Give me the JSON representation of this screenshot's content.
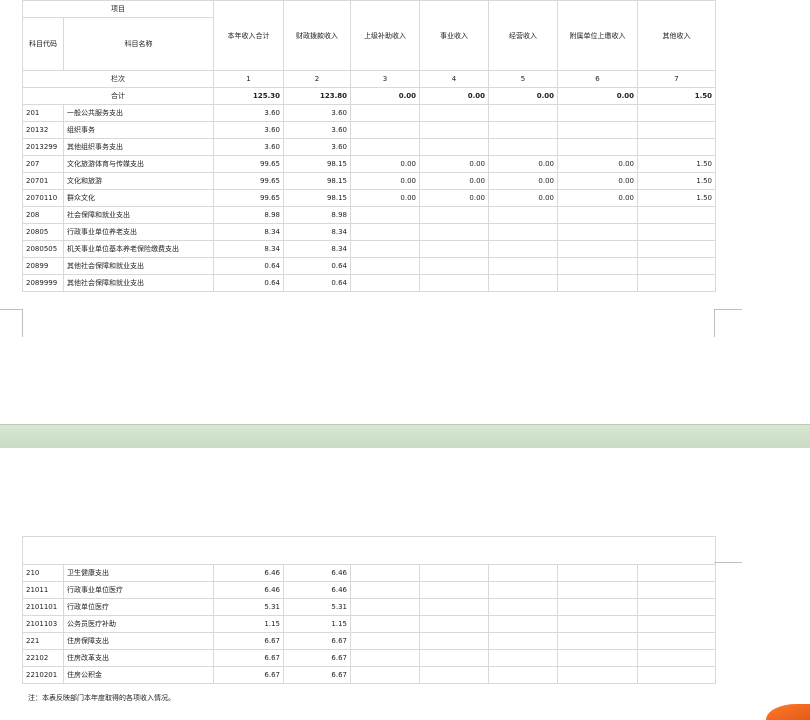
{
  "headers": {
    "project": "项目",
    "code": "科目代码",
    "name": "科目名称",
    "columns": [
      "本年收入合计",
      "财政拨款收入",
      "上级补助收入",
      "事业收入",
      "经营收入",
      "附属单位上缴收入",
      "其他收入"
    ],
    "row_label": "栏次",
    "col_numbers": [
      "1",
      "2",
      "3",
      "4",
      "5",
      "6",
      "7"
    ]
  },
  "total": {
    "label": "合计",
    "values": [
      "125.30",
      "123.80",
      "0.00",
      "0.00",
      "0.00",
      "0.00",
      "1.50"
    ]
  },
  "rows_page1": [
    {
      "code": "201",
      "name": "一般公共服务支出",
      "values": [
        "3.60",
        "3.60",
        "",
        "",
        "",
        "",
        ""
      ]
    },
    {
      "code": "20132",
      "name": "组织事务",
      "values": [
        "3.60",
        "3.60",
        "",
        "",
        "",
        "",
        ""
      ]
    },
    {
      "code": "2013299",
      "name": "其他组织事务支出",
      "values": [
        "3.60",
        "3.60",
        "",
        "",
        "",
        "",
        ""
      ]
    },
    {
      "code": "207",
      "name": "文化旅游体育与传媒支出",
      "values": [
        "99.65",
        "98.15",
        "0.00",
        "0.00",
        "0.00",
        "0.00",
        "1.50"
      ]
    },
    {
      "code": "20701",
      "name": "文化和旅游",
      "values": [
        "99.65",
        "98.15",
        "0.00",
        "0.00",
        "0.00",
        "0.00",
        "1.50"
      ]
    },
    {
      "code": "2070110",
      "name": "群众文化",
      "values": [
        "99.65",
        "98.15",
        "0.00",
        "0.00",
        "0.00",
        "0.00",
        "1.50"
      ]
    },
    {
      "code": "208",
      "name": "社会保障和就业支出",
      "values": [
        "8.98",
        "8.98",
        "",
        "",
        "",
        "",
        ""
      ]
    },
    {
      "code": "20805",
      "name": "行政事业单位养老支出",
      "values": [
        "8.34",
        "8.34",
        "",
        "",
        "",
        "",
        ""
      ]
    },
    {
      "code": "2080505",
      "name": "机关事业单位基本养老保险缴费支出",
      "values": [
        "8.34",
        "8.34",
        "",
        "",
        "",
        "",
        ""
      ]
    },
    {
      "code": "20899",
      "name": "其他社会保障和就业支出",
      "values": [
        "0.64",
        "0.64",
        "",
        "",
        "",
        "",
        ""
      ]
    },
    {
      "code": "2089999",
      "name": "其他社会保障和就业支出",
      "values": [
        "0.64",
        "0.64",
        "",
        "",
        "",
        "",
        ""
      ]
    }
  ],
  "rows_page2": [
    {
      "code": "210",
      "name": "卫生健康支出",
      "values": [
        "6.46",
        "6.46",
        "",
        "",
        "",
        "",
        ""
      ]
    },
    {
      "code": "21011",
      "name": "行政事业单位医疗",
      "values": [
        "6.46",
        "6.46",
        "",
        "",
        "",
        "",
        ""
      ]
    },
    {
      "code": "2101101",
      "name": "行政单位医疗",
      "values": [
        "5.31",
        "5.31",
        "",
        "",
        "",
        "",
        ""
      ]
    },
    {
      "code": "2101103",
      "name": "公务员医疗补助",
      "values": [
        "1.15",
        "1.15",
        "",
        "",
        "",
        "",
        ""
      ]
    },
    {
      "code": "221",
      "name": "住房保障支出",
      "values": [
        "6.67",
        "6.67",
        "",
        "",
        "",
        "",
        ""
      ]
    },
    {
      "code": "22102",
      "name": "住房改革支出",
      "values": [
        "6.67",
        "6.67",
        "",
        "",
        "",
        "",
        ""
      ]
    },
    {
      "code": "2210201",
      "name": "住房公积金",
      "values": [
        "6.67",
        "6.67",
        "",
        "",
        "",
        "",
        ""
      ]
    }
  ],
  "note": "注：本表反映部门本年度取得的各项收入情况。"
}
